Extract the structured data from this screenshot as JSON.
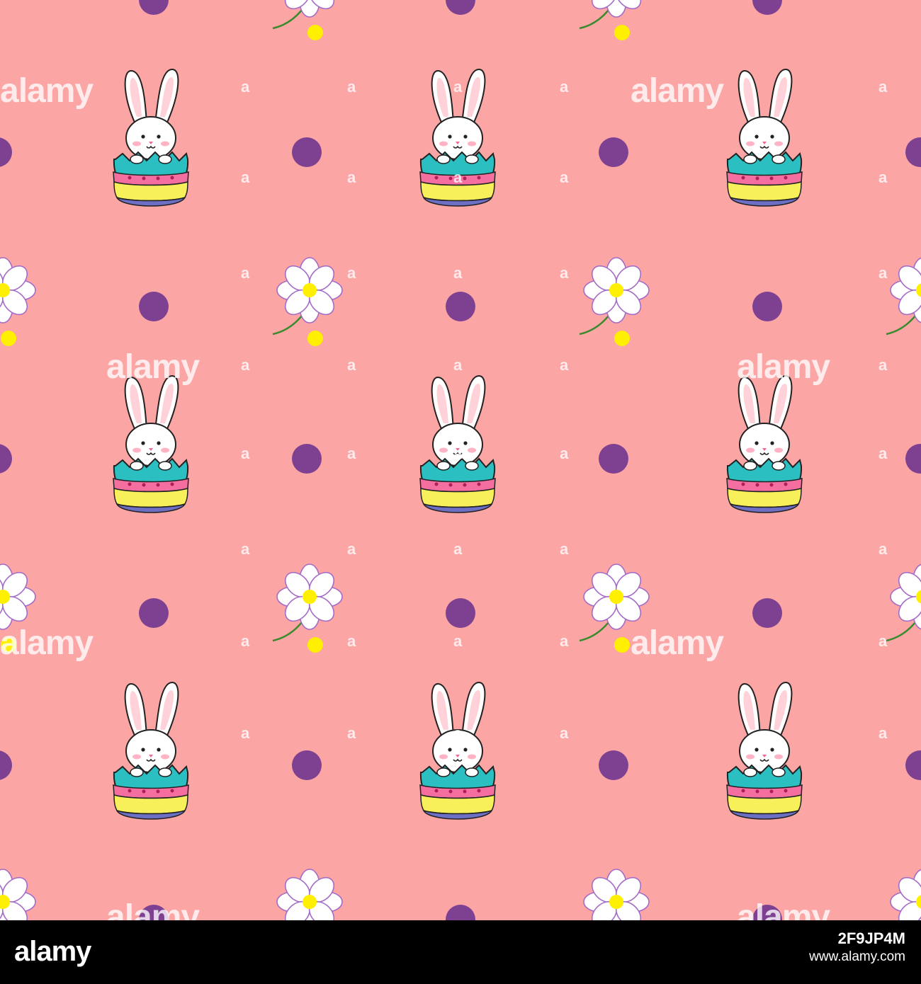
{
  "pattern": {
    "background_color": "#fca5a5",
    "dot_color": "#7e4192",
    "bunny_icon": "bunny-in-egg-icon",
    "flower_icon": "daisy-flower-icon",
    "egg_colors": {
      "top_band": "#2bbfc2",
      "middle_band": "#f7f05a",
      "bottom_band": "#6d6fc5",
      "pink_band": "#f46fa0",
      "dots": "#b01e5a"
    },
    "flower_colors": {
      "petals": "#ffffff",
      "petal_lines": "#a46bc7",
      "center": "#ffef00",
      "stem": "#3a8a2e"
    }
  },
  "watermark": {
    "text": "alamy",
    "small_text": "a"
  },
  "footer": {
    "logo_text": "alamy",
    "image_id": "2F9JP4M",
    "url": "www.alamy.com"
  }
}
